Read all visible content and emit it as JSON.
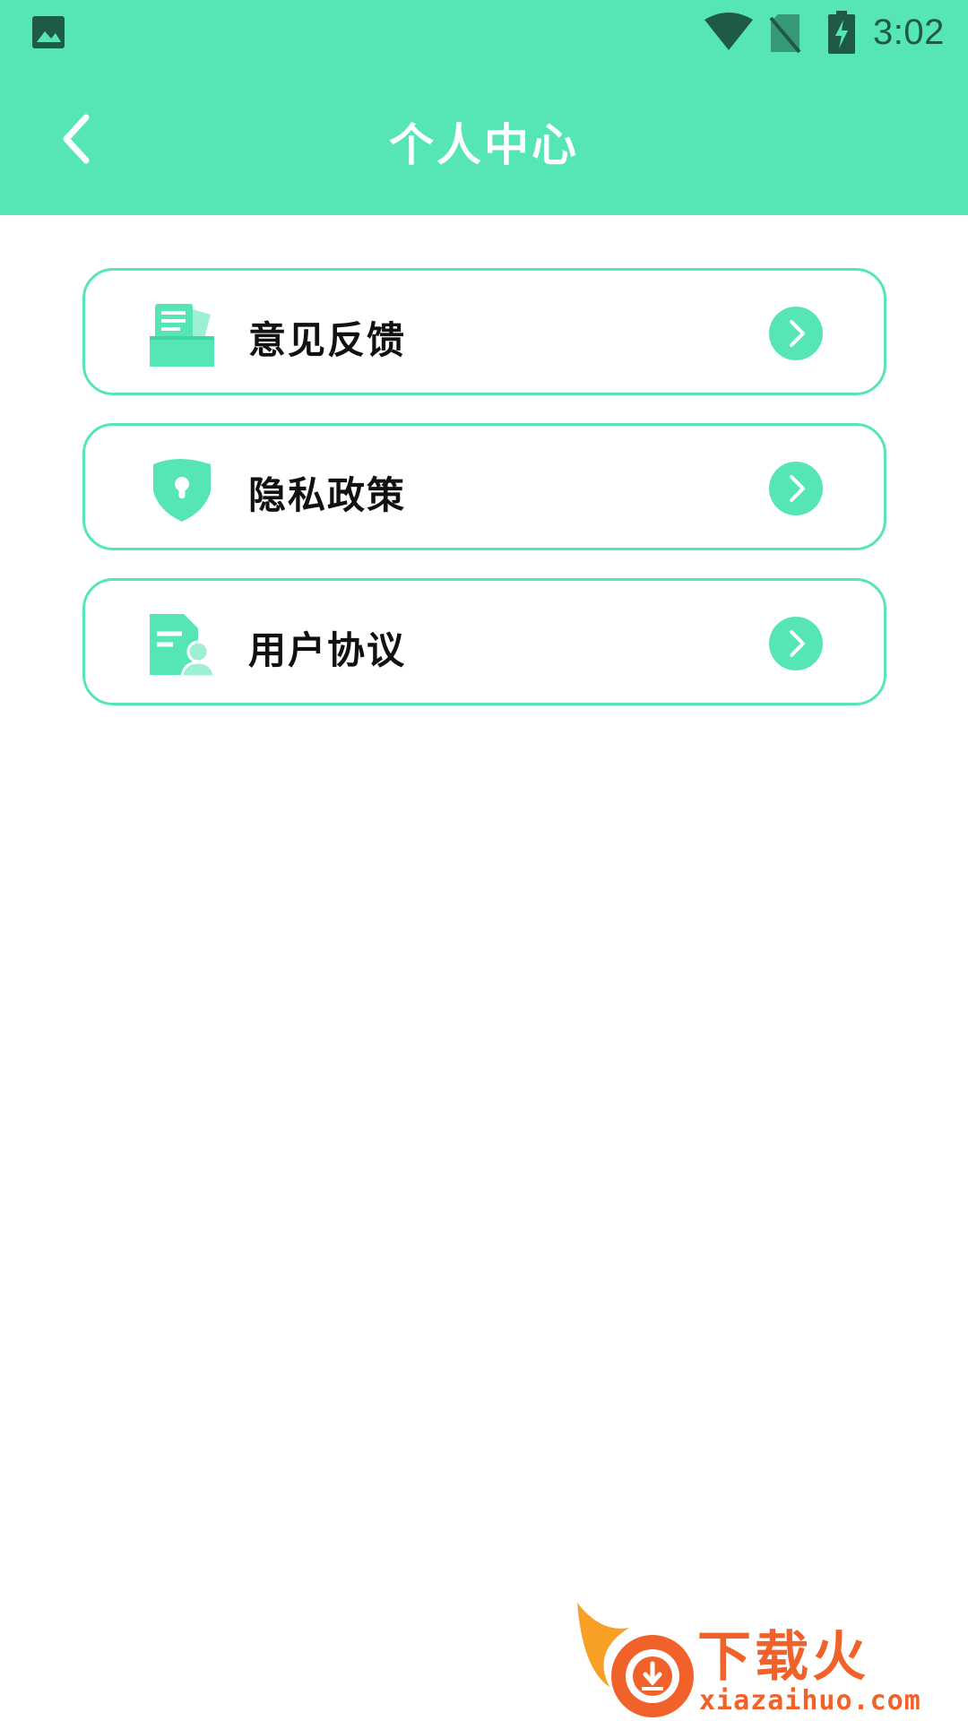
{
  "status_bar": {
    "time": "3:02",
    "icons": [
      "gallery-icon",
      "wifi-icon",
      "no-sim-icon",
      "battery-charging-icon"
    ]
  },
  "header": {
    "title": "个人中心",
    "back_icon": "chevron-left-icon"
  },
  "menu": {
    "items": [
      {
        "label": "意见反馈",
        "icon": "feedback-icon"
      },
      {
        "label": "隐私政策",
        "icon": "privacy-shield-icon"
      },
      {
        "label": "用户协议",
        "icon": "user-agreement-icon"
      }
    ],
    "arrow_icon": "chevron-right-circle-icon"
  },
  "watermark": {
    "text": "下载火",
    "url": "xiazaihuo.com"
  },
  "colors": {
    "accent": "#56e6b4",
    "status_icons": "#1f5a49",
    "watermark": "#f1622b"
  }
}
